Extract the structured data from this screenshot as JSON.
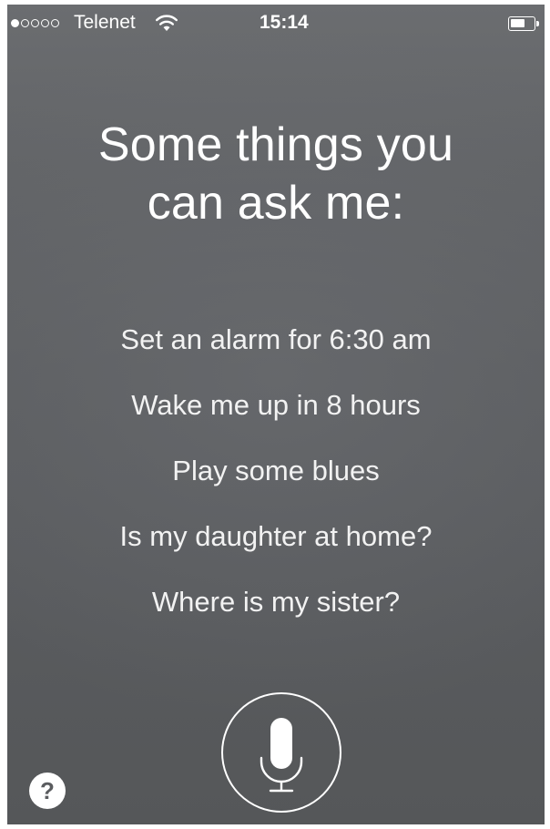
{
  "status_bar": {
    "carrier": "Telenet",
    "time": "15:14",
    "signal_strength": 1,
    "signal_max": 5,
    "battery_level": 0.65,
    "wifi_icon": "wifi-icon",
    "battery_icon": "battery-icon"
  },
  "prompt": {
    "line1": "Some things you",
    "line2": "can ask me:"
  },
  "suggestions": [
    "Set an alarm for 6:30 am",
    "Wake me up in 8 hours",
    "Play some blues",
    "Is my daughter at home?",
    "Where is my sister?"
  ],
  "controls": {
    "mic_icon": "microphone-icon",
    "help_label": "?"
  },
  "colors": {
    "background": "#5e6063",
    "text": "#ffffff"
  }
}
